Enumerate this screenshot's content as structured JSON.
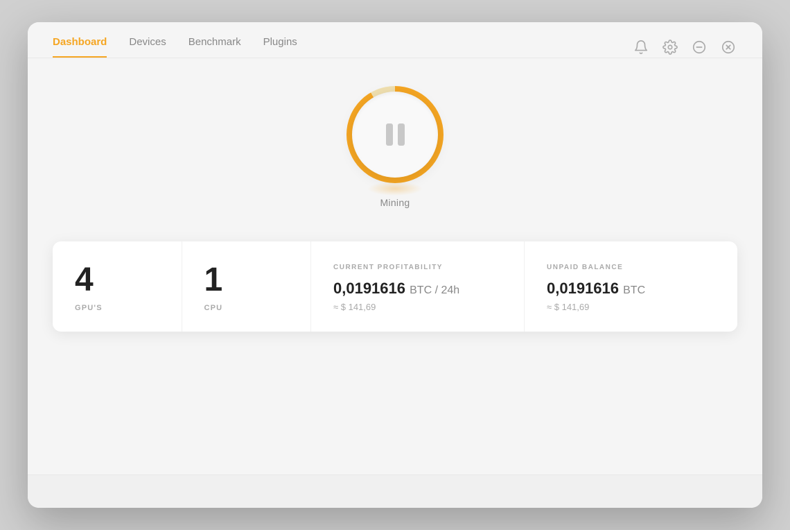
{
  "nav": {
    "tabs": [
      {
        "id": "dashboard",
        "label": "Dashboard",
        "active": true
      },
      {
        "id": "devices",
        "label": "Devices",
        "active": false
      },
      {
        "id": "benchmark",
        "label": "Benchmark",
        "active": false
      },
      {
        "id": "plugins",
        "label": "Plugins",
        "active": false
      }
    ]
  },
  "mining": {
    "button_label": "Mining",
    "status": "paused"
  },
  "stats": {
    "gpu_count": "4",
    "gpu_label": "GPU'S",
    "cpu_count": "1",
    "cpu_label": "CPU",
    "profitability": {
      "label": "CURRENT PROFITABILITY",
      "btc_value": "0,0191616",
      "btc_unit": "BTC / 24h",
      "usd_value": "≈ $ 141,69"
    },
    "balance": {
      "label": "UNPAID BALANCE",
      "btc_value": "0,0191616",
      "btc_unit": "BTC",
      "usd_value": "≈ $ 141,69"
    }
  },
  "accent_color": "#f5a623"
}
